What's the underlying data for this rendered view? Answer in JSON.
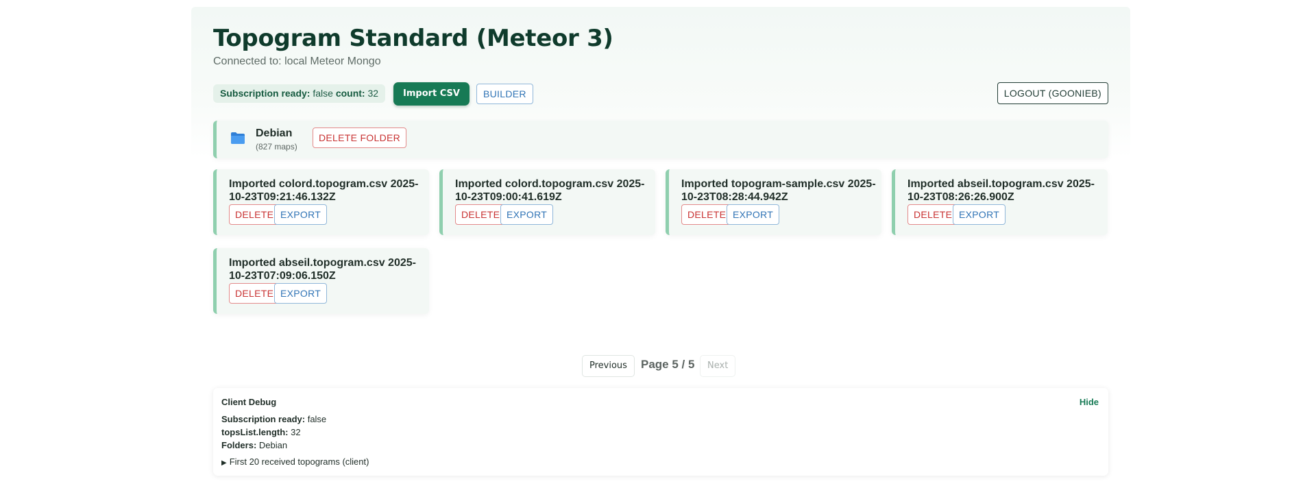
{
  "header": {
    "title": "Topogram Standard (Meteor 3)",
    "subtitle": "Connected to: local Meteor Mongo"
  },
  "toolbar": {
    "subscription_label": "Subscription ready:",
    "subscription_value": "false",
    "count_label": "count:",
    "count_value": "32",
    "import_label": "Import CSV",
    "builder_label": "BUILDER",
    "logout_label": "LOGOUT (GOONIEB)"
  },
  "folder": {
    "name": "Debian",
    "count": "(827 maps)",
    "delete_label": "DELETE FOLDER",
    "icon": "folder-icon",
    "icon_color": "#3a8ee6"
  },
  "cards": [
    {
      "title": "Imported colord.topogram.csv 2025-10-23T09:21:46.132Z",
      "delete_label": "DELETE",
      "export_label": "EXPORT"
    },
    {
      "title": "Imported colord.topogram.csv 2025-10-23T09:00:41.619Z",
      "delete_label": "DELETE",
      "export_label": "EXPORT"
    },
    {
      "title": "Imported topogram-sample.csv 2025-10-23T08:28:44.942Z",
      "delete_label": "DELETE",
      "export_label": "EXPORT"
    },
    {
      "title": "Imported abseil.topogram.csv 2025-10-23T08:26:26.900Z",
      "delete_label": "DELETE",
      "export_label": "EXPORT"
    },
    {
      "title": "Imported abseil.topogram.csv 2025-10-23T07:09:06.150Z",
      "delete_label": "DELETE",
      "export_label": "EXPORT"
    }
  ],
  "pagination": {
    "previous_label": "Previous",
    "page_label": "Page 5 / 5",
    "next_label": "Next"
  },
  "debug": {
    "title": "Client Debug",
    "hide_label": "Hide",
    "subscription_label": "Subscription ready:",
    "subscription_value": "false",
    "topslist_label": "topsList.length:",
    "topslist_value": "32",
    "folders_label": "Folders:",
    "folders_value": "Debian",
    "details_summary": "First 20 received topograms (client)"
  },
  "colors": {
    "accent": "#177a55",
    "danger": "#c83232",
    "info": "#2f73b5",
    "card_border": "#8fcfae"
  }
}
